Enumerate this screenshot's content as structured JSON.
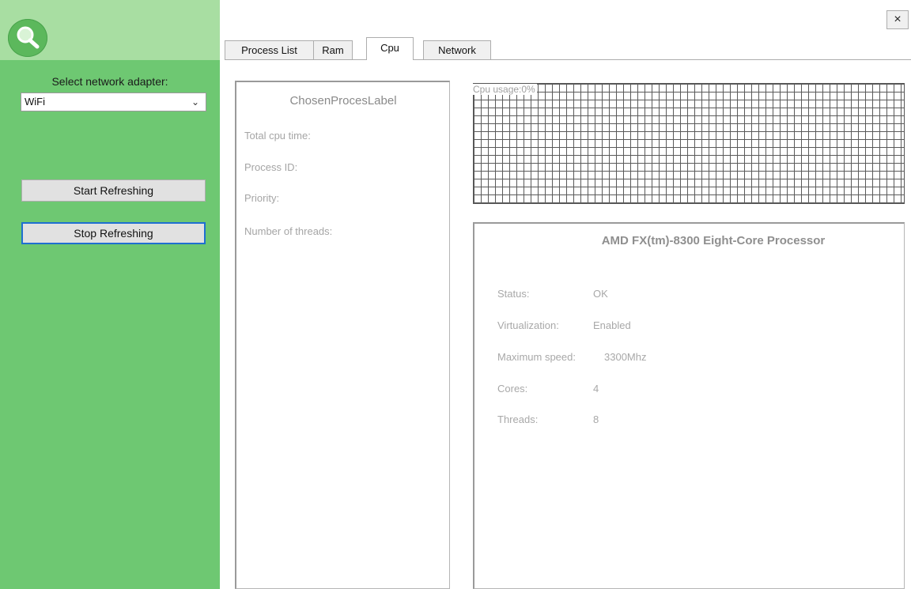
{
  "sidebar": {
    "adapter_label": "Select network adapter:",
    "adapter_selected": "WiFi",
    "start_label": "Start Refreshing",
    "stop_label": "Stop Refreshing",
    "logo_icon": "magnifier-icon"
  },
  "window": {
    "close_label": "×"
  },
  "tabs": [
    {
      "label": "Process List"
    },
    {
      "label": "Ram"
    },
    {
      "label": "Cpu",
      "active": true
    },
    {
      "label": "Network"
    }
  ],
  "process_panel": {
    "title": "ChosenProcesLabel",
    "total_cpu_time": "Total cpu time:",
    "process_id": "Process ID:",
    "priority": "Priority:",
    "threads": "Number of threads:"
  },
  "cpu_graph": {
    "label": "Cpu usage:0%"
  },
  "cpu_info": {
    "name": "AMD FX(tm)-8300 Eight-Core Processor",
    "rows": [
      {
        "key": "Status:",
        "value": "OK"
      },
      {
        "key": "Virtualization:",
        "value": "Enabled"
      },
      {
        "key": "Maximum speed:",
        "value": "3300Mhz"
      },
      {
        "key": "Cores:",
        "value": "4"
      },
      {
        "key": "Threads:",
        "value": "8"
      }
    ]
  },
  "colors": {
    "sidebar": "#6ec872",
    "sidebar_header": "#a8dea2",
    "focus_border": "#1f6fd0"
  }
}
